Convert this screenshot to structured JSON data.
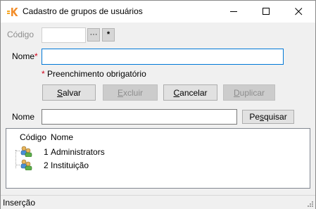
{
  "window": {
    "title": "Cadastro de grupos de usuários"
  },
  "form": {
    "codigo_label": "Código",
    "codigo_value": "",
    "browse_btn": "···",
    "new_btn": "*",
    "nome_label": "Nome",
    "nome_required_mark": "*",
    "nome_value": "",
    "required_note_mark": "*",
    "required_note": "Preenchimento obrigatório"
  },
  "actions": {
    "salvar": {
      "pre": "",
      "key": "S",
      "post": "alvar"
    },
    "excluir": {
      "pre": "",
      "key": "E",
      "post": "xcluir"
    },
    "cancelar": {
      "pre": "",
      "key": "C",
      "post": "ancelar"
    },
    "duplicar": {
      "pre": "",
      "key": "D",
      "post": "uplicar"
    }
  },
  "search": {
    "nome_label": "Nome",
    "value": "",
    "button": {
      "pre": "Pe",
      "key": "s",
      "post": "quisar"
    }
  },
  "list": {
    "columns": [
      "Código",
      "Nome"
    ],
    "rows": [
      {
        "codigo": "1",
        "nome": "Administrators"
      },
      {
        "codigo": "2",
        "nome": "Instituição"
      }
    ]
  },
  "status": {
    "text": "Inserção"
  },
  "colors": {
    "required": "#d0021b",
    "focus": "#0078d7",
    "accent": "#f28c28"
  }
}
